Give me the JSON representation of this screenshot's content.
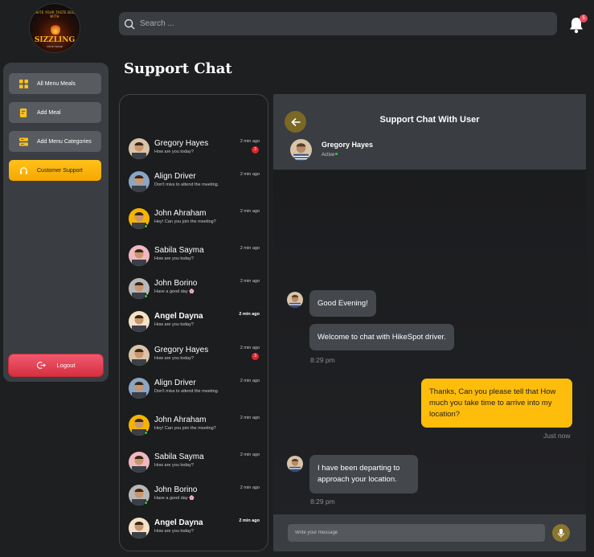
{
  "logo": {
    "tagline": "IGNITE YOUR TASTE BUDS WITH",
    "brand": "SIZZLING",
    "sub": "CHOP HOUSE"
  },
  "search": {
    "placeholder": "Search ..."
  },
  "notifications": {
    "count": "5"
  },
  "sidebar": {
    "items": [
      {
        "label": "All Menu Meals",
        "icon": "grid-icon",
        "active": false
      },
      {
        "label": "Add Meal",
        "icon": "add-document-icon",
        "active": false
      },
      {
        "label": "Add Menu Categories",
        "icon": "list-icon",
        "active": false
      },
      {
        "label": "Customer Support",
        "icon": "headset-icon",
        "active": true
      }
    ],
    "logout_label": "Logout"
  },
  "page": {
    "title": "Support Chat"
  },
  "chat_list": [
    {
      "name": "Gregory Hayes",
      "preview": "How are you today?",
      "time": "2 min ago",
      "unread": "3",
      "bold": false,
      "online": false,
      "avatar_color": "#d9c4a8"
    },
    {
      "name": "Align Driver",
      "preview": "Don't miss to attend the meeting.",
      "time": "2 min ago",
      "unread": "",
      "bold": false,
      "online": false,
      "avatar_color": "#8aa6c4"
    },
    {
      "name": "John Ahraham",
      "preview": "Hey! Can you join the meeting?",
      "time": "2 min ago",
      "unread": "",
      "bold": false,
      "online": true,
      "avatar_color": "#f5b400"
    },
    {
      "name": "Sabila Sayma",
      "preview": "How are you today?",
      "time": "2 min ago",
      "unread": "",
      "bold": false,
      "online": false,
      "avatar_color": "#f2b8bf"
    },
    {
      "name": "John Borino",
      "preview": "Have a good day 🌸",
      "time": "2 min ago",
      "unread": "",
      "bold": false,
      "online": true,
      "avatar_color": "#b8b8b8"
    },
    {
      "name": "Angel Dayna",
      "preview": "How are you today?",
      "time": "2 min ago",
      "unread": "",
      "bold": true,
      "online": false,
      "avatar_color": "#f4e2c8"
    },
    {
      "name": "Gregory Hayes",
      "preview": "How are you today?",
      "time": "2 min ago",
      "unread": "3",
      "bold": false,
      "online": false,
      "avatar_color": "#d9c4a8"
    },
    {
      "name": "Align Driver",
      "preview": "Don't miss to attend the meeting.",
      "time": "2 min ago",
      "unread": "",
      "bold": false,
      "online": false,
      "avatar_color": "#8aa6c4"
    },
    {
      "name": "John Ahraham",
      "preview": "Hey! Can you join the meeting?",
      "time": "2 min ago",
      "unread": "",
      "bold": false,
      "online": true,
      "avatar_color": "#f5b400"
    },
    {
      "name": "Sabila Sayma",
      "preview": "How are you today?",
      "time": "2 min ago",
      "unread": "",
      "bold": false,
      "online": false,
      "avatar_color": "#f2b8bf"
    },
    {
      "name": "John Borino",
      "preview": "Have a good day 🌸",
      "time": "2 min ago",
      "unread": "",
      "bold": false,
      "online": true,
      "avatar_color": "#b8b8b8"
    },
    {
      "name": "Angel Dayna",
      "preview": "How are you today?",
      "time": "2 min ago",
      "unread": "",
      "bold": true,
      "online": false,
      "avatar_color": "#f4e2c8"
    }
  ],
  "chat": {
    "title": "Support Chat With User",
    "user_name": "Gregory Hayes",
    "user_status": "Active",
    "messages": [
      {
        "text": "Good Evening!",
        "from": "user"
      },
      {
        "text": "Welcome to chat with HikeSpot driver.",
        "from": "user",
        "time": "8:29 pm"
      },
      {
        "text": "Thanks, Can you please tell that How much you take time to arrive into my location?",
        "from": "me",
        "time": "Just now"
      },
      {
        "text": "I have been departing to approach your location.",
        "from": "user",
        "time": "8:29 pm"
      }
    ],
    "composer_placeholder": "Write your message"
  },
  "colors": {
    "accent": "#ffbd0b",
    "danger": "#e0303f",
    "panel": "#3a3d42",
    "background": "#1e1f21"
  }
}
